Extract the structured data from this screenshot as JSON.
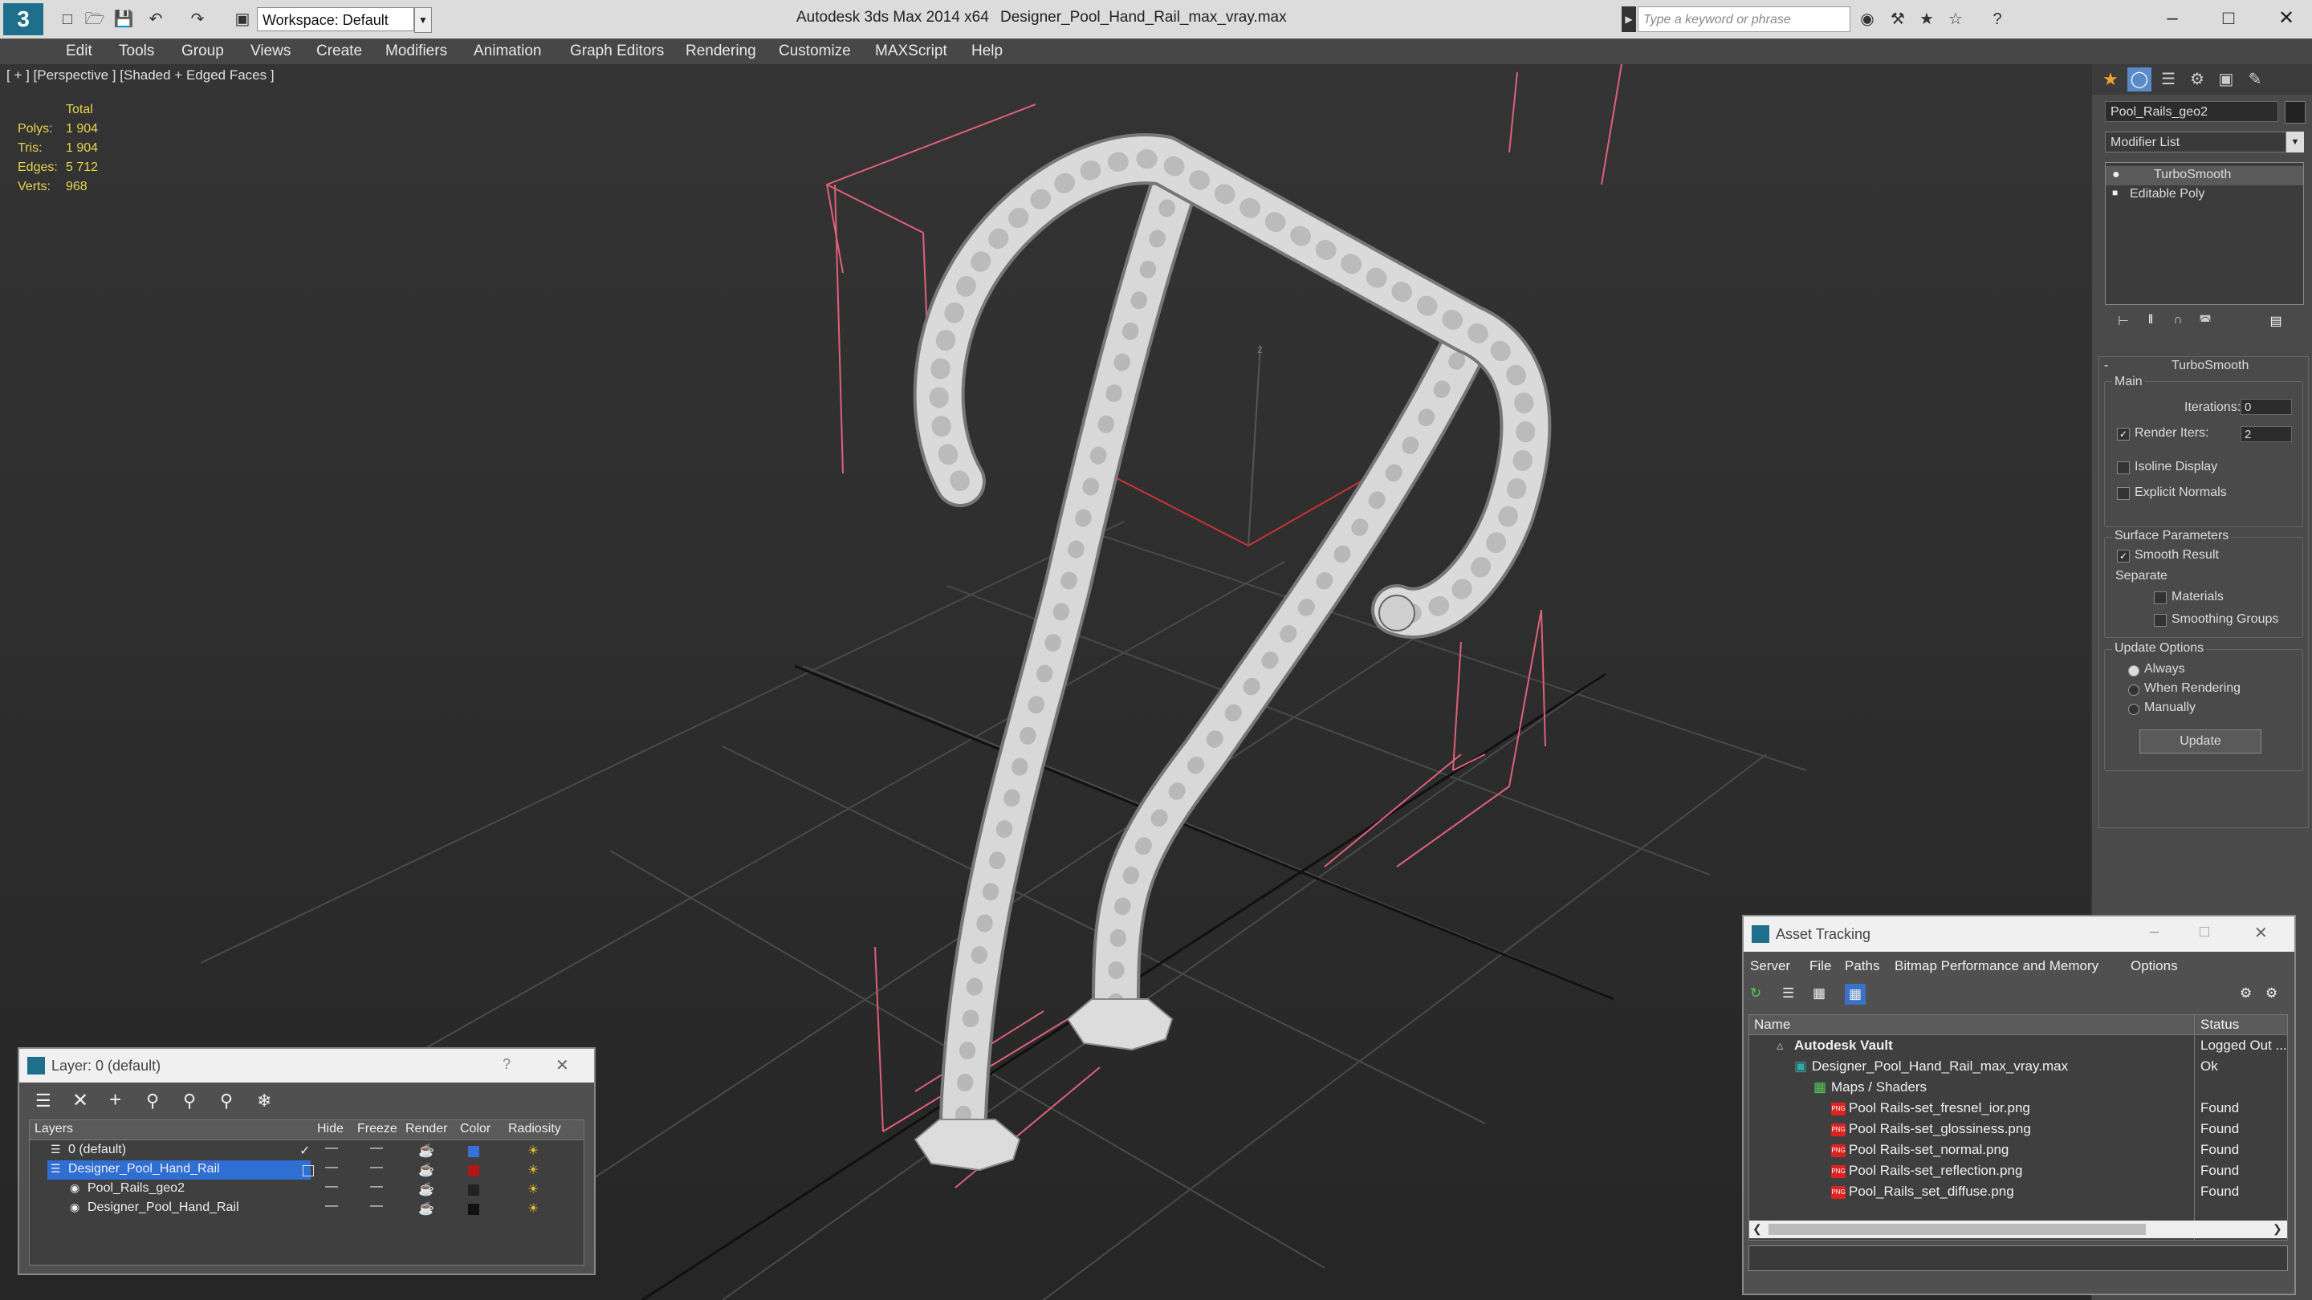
{
  "app": {
    "title": "Autodesk 3ds Max  2014 x64",
    "file": "Designer_Pool_Hand_Rail_max_vray.max",
    "workspace": "Workspace: Default",
    "search_placeholder": "Type a keyword or phrase"
  },
  "menu": [
    "Edit",
    "Tools",
    "Group",
    "Views",
    "Create",
    "Modifiers",
    "Animation",
    "Graph Editors",
    "Rendering",
    "Customize",
    "MAXScript",
    "Help"
  ],
  "viewport": {
    "label": "[ + ] [Perspective ] [Shaded + Edged Faces ]",
    "stats": {
      "header": "Total",
      "rows": [
        {
          "label": "Polys:",
          "value": "1 904"
        },
        {
          "label": "Tris:",
          "value": "1 904"
        },
        {
          "label": "Edges:",
          "value": "5 712"
        },
        {
          "label": "Verts:",
          "value": "968"
        }
      ]
    },
    "axis_label": "z"
  },
  "command_panel": {
    "object_name": "Pool_Rails_geo2",
    "modifier_list": "Modifier List",
    "stack": [
      "TurboSmooth",
      "Editable Poly"
    ],
    "rollout_title": "TurboSmooth",
    "main_group": "Main",
    "iterations_label": "Iterations:",
    "iterations_value": "0",
    "render_iters_label": "Render Iters:",
    "render_iters_value": "2",
    "isoline": "Isoline Display",
    "explicit_normals": "Explicit Normals",
    "surface_params": "Surface Parameters",
    "smooth_result": "Smooth Result",
    "separate": "Separate",
    "materials": "Materials",
    "smoothing_groups": "Smoothing Groups",
    "update_options": "Update Options",
    "always": "Always",
    "when_rendering": "When Rendering",
    "manually": "Manually",
    "update_button": "Update"
  },
  "layer_dialog": {
    "title": "Layer: 0 (default)",
    "columns": [
      "Layers",
      "Hide",
      "Freeze",
      "Render",
      "Color",
      "Radiosity"
    ],
    "rows": [
      {
        "name": "0 (default)",
        "color": "#3a6fd8"
      },
      {
        "name": "Designer_Pool_Hand_Rail",
        "color": "#b01818"
      },
      {
        "name": "Pool_Rails_geo2",
        "color": "#222222"
      },
      {
        "name": "Designer_Pool_Hand_Rail",
        "color": "#111111"
      }
    ]
  },
  "asset_dialog": {
    "title": "Asset Tracking",
    "menu": [
      "Server",
      "File",
      "Paths",
      "Bitmap Performance and Memory",
      "Options"
    ],
    "columns": [
      "Name",
      "Status"
    ],
    "rows": [
      {
        "name": "Autodesk Vault",
        "status": "Logged Out ..."
      },
      {
        "name": "Designer_Pool_Hand_Rail_max_vray.max",
        "status": "Ok"
      },
      {
        "name": "Maps / Shaders",
        "status": ""
      },
      {
        "name": "Pool Rails-set_fresnel_ior.png",
        "status": "Found"
      },
      {
        "name": "Pool Rails-set_glossiness.png",
        "status": "Found"
      },
      {
        "name": "Pool Rails-set_normal.png",
        "status": "Found"
      },
      {
        "name": "Pool Rails-set_reflection.png",
        "status": "Found"
      },
      {
        "name": "Pool_Rails_set_diffuse.png",
        "status": "Found"
      }
    ]
  }
}
